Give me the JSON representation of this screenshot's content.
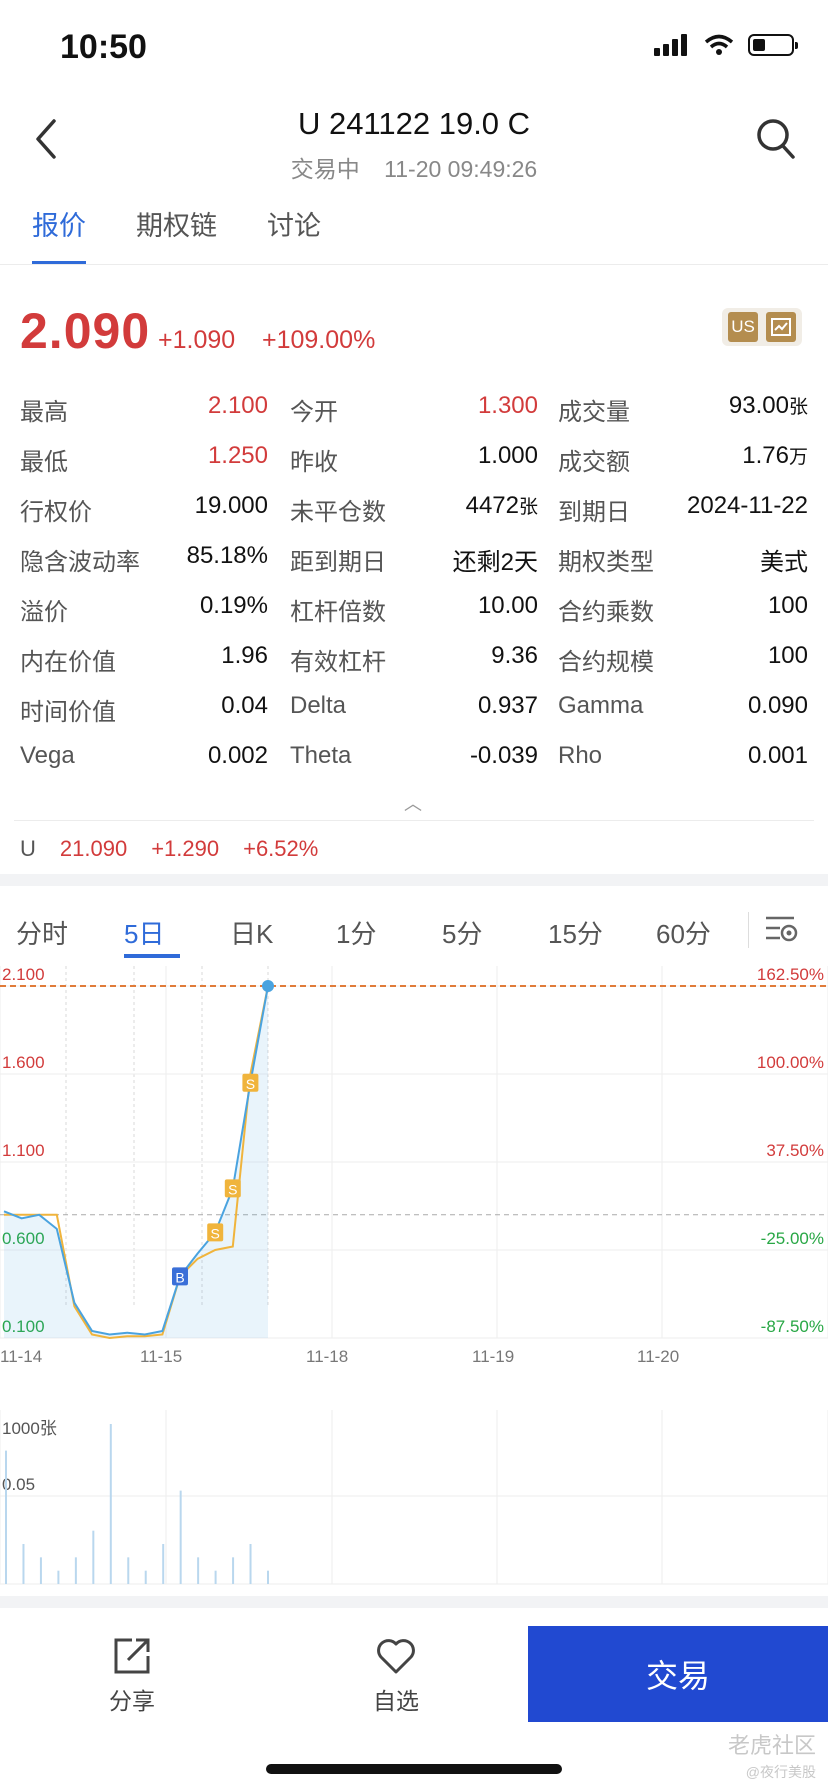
{
  "status_bar": {
    "time": "10:50"
  },
  "header": {
    "title": "U 241122 19.0 C",
    "status": "交易中",
    "datetime": "11-20 09:49:26"
  },
  "tabs": [
    {
      "label": "报价",
      "active": true
    },
    {
      "label": "期权链",
      "active": false
    },
    {
      "label": "讨论",
      "active": false
    }
  ],
  "quote": {
    "price": "2.090",
    "change": "+1.090",
    "change_pct": "+109.00%",
    "badge": "US",
    "up_color": "#d23b3b",
    "down_color": "#28a745"
  },
  "stats": [
    [
      {
        "label": "最高",
        "value": "2.100",
        "color": "red"
      },
      {
        "label": "今开",
        "value": "1.300",
        "color": "red"
      },
      {
        "label": "成交量",
        "value": "93.00",
        "unit": "张"
      }
    ],
    [
      {
        "label": "最低",
        "value": "1.250",
        "color": "red"
      },
      {
        "label": "昨收",
        "value": "1.000"
      },
      {
        "label": "成交额",
        "value": "1.76",
        "unit": "万"
      }
    ],
    [
      {
        "label": "行权价",
        "value": "19.000"
      },
      {
        "label": "未平仓数",
        "value": "4472",
        "unit": "张"
      },
      {
        "label": "到期日",
        "value": "2024-11-22"
      }
    ],
    [
      {
        "label": "隐含波动率",
        "value": "85.18%"
      },
      {
        "label": "距到期日",
        "value": "还剩2天"
      },
      {
        "label": "期权类型",
        "value": "美式"
      }
    ],
    [
      {
        "label": "溢价",
        "value": "0.19%"
      },
      {
        "label": "杠杆倍数",
        "value": "10.00"
      },
      {
        "label": "合约乘数",
        "value": "100"
      }
    ],
    [
      {
        "label": "内在价值",
        "value": "1.96"
      },
      {
        "label": "有效杠杆",
        "value": "9.36"
      },
      {
        "label": "合约规模",
        "value": "100"
      }
    ],
    [
      {
        "label": "时间价值",
        "value": "0.04"
      },
      {
        "label": "Delta",
        "value": "0.937"
      },
      {
        "label": "Gamma",
        "value": "0.090"
      }
    ],
    [
      {
        "label": "Vega",
        "value": "0.002"
      },
      {
        "label": "Theta",
        "value": "-0.039"
      },
      {
        "label": "Rho",
        "value": "0.001"
      }
    ]
  ],
  "underlying": {
    "symbol": "U",
    "price": "21.090",
    "change": "+1.290",
    "change_pct": "+6.52%"
  },
  "period_tabs": [
    "分时",
    "5日",
    "日K",
    "1分",
    "5分",
    "15分",
    "60分"
  ],
  "period_active": "5日",
  "chart_data": {
    "type": "line",
    "x": [
      "11-14",
      "11-14",
      "11-14",
      "11-14",
      "11-14",
      "11-14",
      "11-15",
      "11-15",
      "11-15",
      "11-15",
      "11-15",
      "11-15",
      "11-15",
      "11-15",
      "11-15",
      "11-15"
    ],
    "x_tick_labels": [
      "11-14",
      "11-15",
      "11-18",
      "11-19",
      "11-20"
    ],
    "y_tick_labels_left": [
      "2.100",
      "1.600",
      "1.100",
      "0.600",
      "0.100"
    ],
    "y_tick_labels_right": [
      "162.50%",
      "100.00%",
      "37.50%",
      "-25.00%",
      "-87.50%"
    ],
    "ylim": [
      0.1,
      2.1
    ],
    "reference_value": 0.8,
    "high_value": 2.1,
    "series": [
      {
        "color": "#4aa3df",
        "values": [
          0.82,
          0.78,
          0.8,
          0.72,
          0.3,
          0.14,
          0.12,
          0.13,
          0.12,
          0.14,
          0.45,
          0.58,
          0.7,
          0.95,
          1.55,
          2.1
        ]
      },
      {
        "color": "#f0b43c",
        "values": [
          0.8,
          0.8,
          0.8,
          0.8,
          0.28,
          0.12,
          0.1,
          0.11,
          0.11,
          0.12,
          0.45,
          0.55,
          0.6,
          0.62,
          1.6,
          2.1
        ]
      }
    ],
    "markers": [
      {
        "label": "B",
        "x_index": 10,
        "value": 0.45,
        "color": "#3a6fd8"
      },
      {
        "label": "S",
        "x_index": 12,
        "value": 0.7,
        "color": "#f0b43c"
      },
      {
        "label": "S",
        "x_index": 13,
        "value": 0.95,
        "color": "#f0b43c"
      },
      {
        "label": "S",
        "x_index": 14,
        "value": 1.55,
        "color": "#f0b43c"
      }
    ]
  },
  "volume": {
    "unit_label": "1000张",
    "tick_label": "0.05",
    "values": [
      0.1,
      0.03,
      0.02,
      0.01,
      0.02,
      0.04,
      0.12,
      0.02,
      0.01,
      0.03,
      0.07,
      0.02,
      0.01,
      0.02,
      0.03,
      0.01
    ]
  },
  "bottom_bar": {
    "share": "分享",
    "watchlist": "自选",
    "trade": "交易"
  },
  "watermark": {
    "line1": "老虎社区",
    "line2": "@夜行美股"
  }
}
